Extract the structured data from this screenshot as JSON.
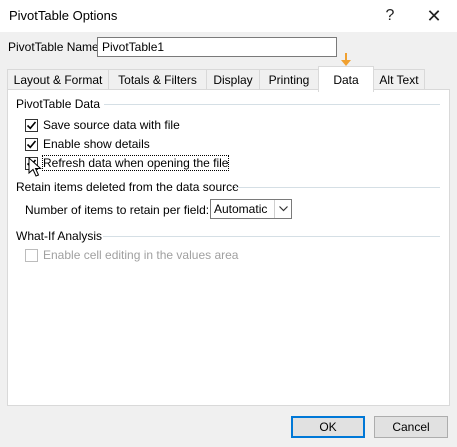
{
  "window": {
    "title": "PivotTable Options",
    "help_label": "?",
    "close_label": "✕"
  },
  "name_field": {
    "label": "PivotTable Name:",
    "value": "PivotTable1"
  },
  "tabs": [
    {
      "label": "Layout & Format",
      "active": false
    },
    {
      "label": "Totals & Filters",
      "active": false
    },
    {
      "label": "Display",
      "active": false
    },
    {
      "label": "Printing",
      "active": false
    },
    {
      "label": "Data",
      "active": true
    },
    {
      "label": "Alt Text",
      "active": false
    }
  ],
  "pivot_data": {
    "heading": "PivotTable Data",
    "options": [
      {
        "label": "Save source data with file",
        "checked": true
      },
      {
        "label": "Enable show details",
        "checked": true
      },
      {
        "label": "Refresh data when opening the file",
        "checked": true
      }
    ]
  },
  "retain": {
    "heading": "Retain items deleted from the data source",
    "field_label": "Number of items to retain per field:",
    "selected": "Automatic"
  },
  "whatif": {
    "heading": "What-If Analysis",
    "option_label": "Enable cell editing in the values area",
    "checked": false,
    "disabled": true
  },
  "buttons": {
    "ok": "OK",
    "cancel": "Cancel"
  },
  "colors": {
    "accent": "#0078d7",
    "marker": "#f0a030"
  }
}
